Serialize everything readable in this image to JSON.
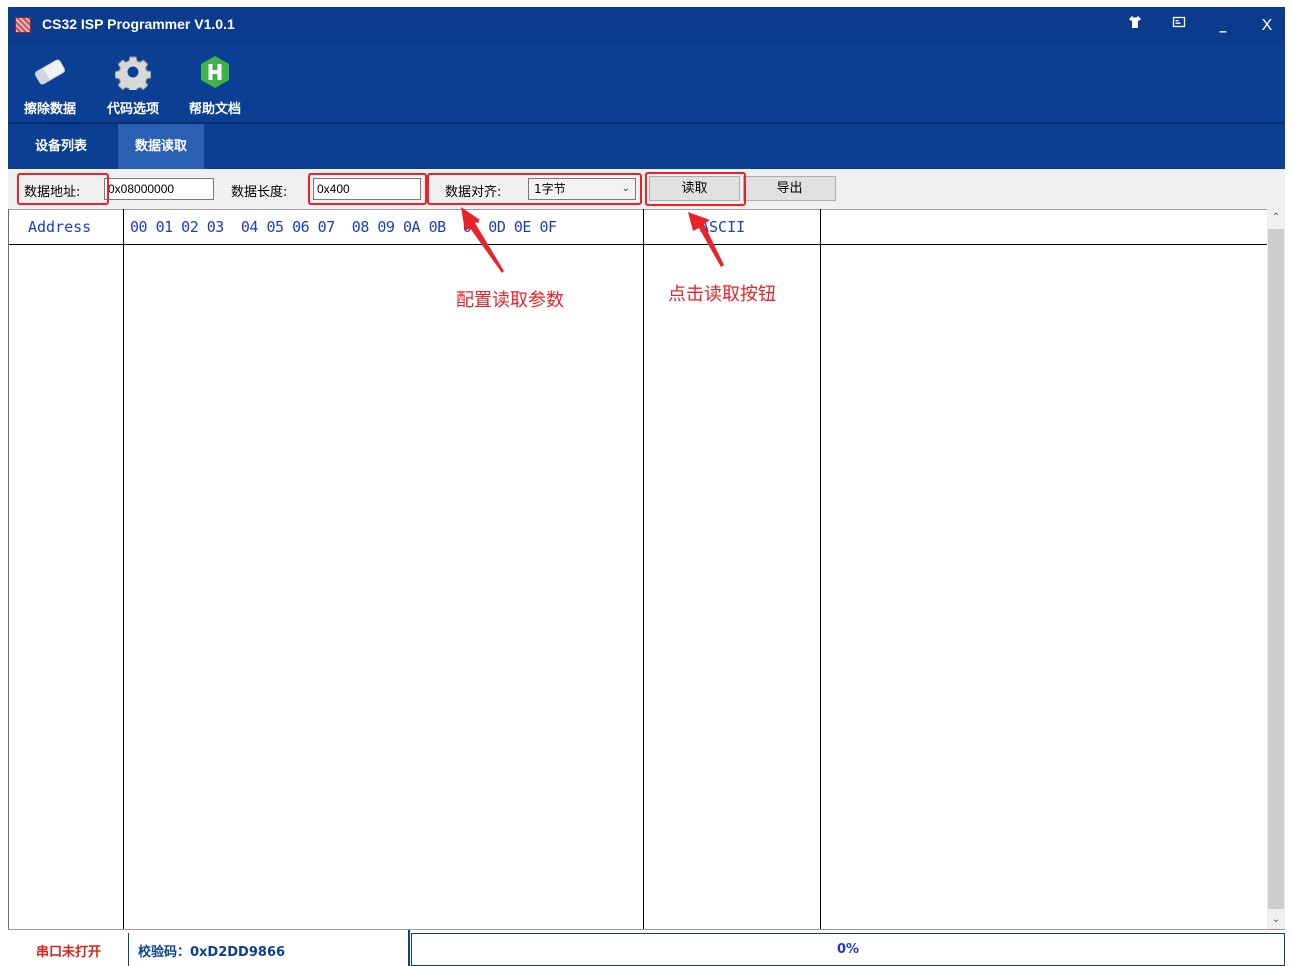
{
  "window": {
    "title": "CS32 ISP Programmer V1.0.1",
    "controls": {
      "skin": "shirt-icon",
      "restore": "restore-icon",
      "minimize": "_",
      "close": "X"
    }
  },
  "toolbar": {
    "items": [
      {
        "label": "擦除数据",
        "icon": "eraser-icon"
      },
      {
        "label": "代码选项",
        "icon": "gear-icon"
      },
      {
        "label": "帮助文档",
        "icon": "help-h-icon"
      }
    ]
  },
  "tabs": [
    {
      "label": "设备列表",
      "active": false
    },
    {
      "label": "数据读取",
      "active": true
    }
  ],
  "controls": {
    "address_label": "数据地址:",
    "address_value": "0x08000000",
    "length_label": "数据长度:",
    "length_value": "0x400",
    "align_label": "数据对齐:",
    "align_value": "1字节",
    "read_button": "读取",
    "export_button": "导出"
  },
  "grid": {
    "headers": {
      "address": "Address",
      "hex": "00 01 02 03  04 05 06 07  08 09 0A 0B  0C 0D 0E 0F",
      "ascii": "ASCII"
    },
    "rows": []
  },
  "annotations": {
    "config": "配置读取参数",
    "click": "点击读取按钮",
    "color": "#e8232a"
  },
  "status": {
    "port": "串口未打开",
    "checksum": "校验码：0xD2DD9866",
    "progress_text": "0%",
    "progress_fraction": 0
  },
  "colors": {
    "titlebar": "#0b3b8c",
    "toolbar": "#0b3f93",
    "active_tab": "#2a60b4",
    "header_text": "#1a3cc8",
    "port_status": "#e11d1d"
  }
}
